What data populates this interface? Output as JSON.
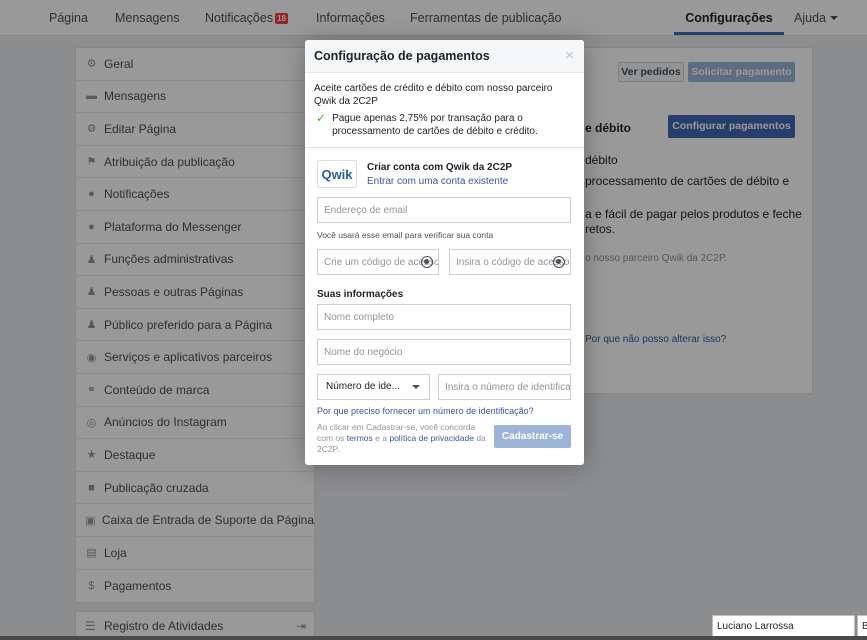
{
  "topnav": {
    "tabs": [
      "Página",
      "Mensagens",
      "Notificações",
      "Informações",
      "Ferramentas de publicação",
      "Configurações",
      "Ajuda"
    ],
    "notification_count": "18",
    "active_tab": "Configurações"
  },
  "sidebar": {
    "items": [
      {
        "label": "Geral",
        "icon": "gear-icon"
      },
      {
        "label": "Mensagens",
        "icon": "chat-icon"
      },
      {
        "label": "Editar Página",
        "icon": "edit-icon"
      },
      {
        "label": "Atribuição da publicação",
        "icon": "flag-icon"
      },
      {
        "label": "Notificações",
        "icon": "globe-icon"
      },
      {
        "label": "Plataforma do Messenger",
        "icon": "messenger-icon"
      },
      {
        "label": "Funções administrativas",
        "icon": "person-icon"
      },
      {
        "label": "Pessoas e outras Páginas",
        "icon": "people-icon"
      },
      {
        "label": "Público preferido para a Página",
        "icon": "audience-icon"
      },
      {
        "label": "Serviços e aplicativos parceiros",
        "icon": "apps-icon"
      },
      {
        "label": "Conteúdo de marca",
        "icon": "handshake-icon"
      },
      {
        "label": "Anúncios do Instagram",
        "icon": "instagram-icon"
      },
      {
        "label": "Destaque",
        "icon": "star-icon"
      },
      {
        "label": "Publicação cruzada",
        "icon": "video-icon"
      },
      {
        "label": "Caixa de Entrada de Suporte da Página",
        "icon": "inbox-icon"
      },
      {
        "label": "Loja",
        "icon": "shop-icon"
      },
      {
        "label": "Pagamentos",
        "icon": "dollar-icon"
      }
    ],
    "activity_log": "Registro de Atividades"
  },
  "background": {
    "view_orders": "Ver pedidos",
    "request_payment": "Solicitar pagamento",
    "debit_heading": "e débito",
    "configure_payments": "Configurar pagamentos",
    "line1": "débito",
    "line2": "processamento de cartões de débito e",
    "line3": "a e fácil de pagar pelos produtos e feche",
    "line4": "retos.",
    "partner_note": "o nosso parceiro Qwik da 2C2P.",
    "why_cant_change": "Por que não posso alterar isso?"
  },
  "dialog": {
    "title": "Configuração de pagamentos",
    "close": "×",
    "intro": "Aceite cartões de crédito e débito com nosso parceiro Qwik da 2C2P",
    "benefit": "Pague apenas 2,75% por transação para o processamento de cartões de débito e crédito.",
    "qwik_logo_text": "Qwik",
    "create_account": "Criar conta com Qwik da 2C2P",
    "login_existing": "Entrar com uma conta existente",
    "email_placeholder": "Endereço de email",
    "email_hint": "Você usará esse email para verificar sua conta",
    "create_code_placeholder": "Crie um código de acesso",
    "enter_code_placeholder": "Insira o código de acesso",
    "your_info": "Suas informações",
    "full_name_placeholder": "Nome completo",
    "business_name_placeholder": "Nome do negócio",
    "id_type_selected": "Número de ide...",
    "id_number_placeholder": "Insira o número de identificação",
    "why_id": "Por que preciso fornecer um número de identificação?",
    "legal_prefix": "Ao clicar em Cadastrar-se, você concorda com os",
    "terms": "termos",
    "legal_and": "e a",
    "privacy": "política de privacidade",
    "legal_suffix": "da 2C2P.",
    "submit": "Cadastrar-se"
  },
  "chat": {
    "name": "Luciano Larrossa",
    "partial": "B"
  },
  "colors": {
    "accent": "#4267b2",
    "disabled_blue": "#9cb4d8",
    "link": "#365899",
    "check": "#42b72a",
    "badge": "#fa3e3e"
  }
}
